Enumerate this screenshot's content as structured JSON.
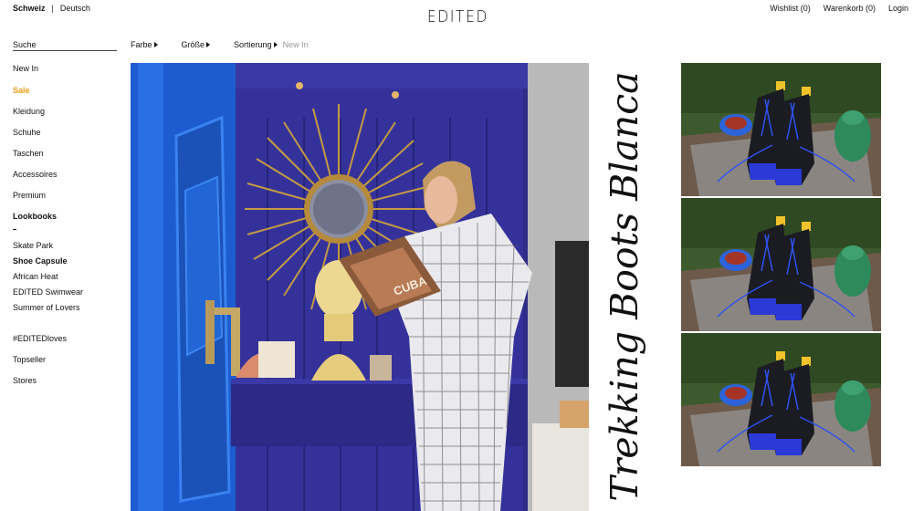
{
  "header": {
    "country": "Schweiz",
    "language": "Deutsch",
    "logo": "EDITED",
    "wishlist": "Wishlist (0)",
    "cart": "Warenkorb (0)",
    "login": "Login"
  },
  "search": {
    "placeholder": "Suche"
  },
  "filters": {
    "color": "Farbe",
    "size": "Größe",
    "sort": "Sortierung",
    "sort_value": "New In"
  },
  "sidebar": {
    "items": [
      "New In",
      "Sale",
      "Kleidung",
      "Schuhe",
      "Taschen",
      "Accessoires",
      "Premium",
      "Lookbooks",
      "Skate Park",
      "Shoe Capsule",
      "African Heat",
      "EDITED Swimwear",
      "Summer of Lovers",
      "#EDITEDloves",
      "Topseller",
      "Stores"
    ]
  },
  "hero": {
    "headline": "Trekking Boots Blanca",
    "magazine_text": "CUBA"
  },
  "colors": {
    "sale": "#f29c12",
    "door_blue": "#1f5fd0",
    "wall_purple": "#2f2f8e"
  }
}
